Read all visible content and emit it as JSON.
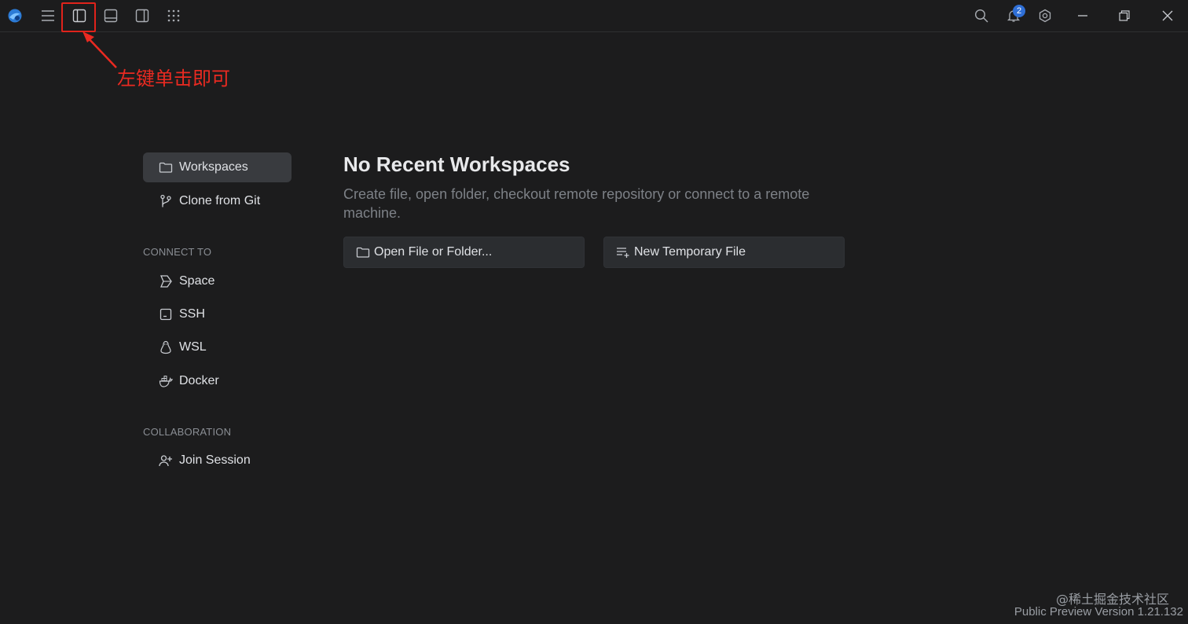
{
  "titlebar": {
    "icons": [
      "app-logo-icon",
      "hamburger-menu-icon",
      "toggle-left-panel-icon",
      "toggle-bottom-panel-icon",
      "toggle-right-panel-icon",
      "grid-apps-icon",
      "search-icon",
      "notification-bell-icon",
      "settings-gear-icon",
      "minimize-icon",
      "restore-icon",
      "close-icon"
    ],
    "notification_count": "2"
  },
  "annotation": {
    "text": "左键单击即可",
    "color": "#e0231b"
  },
  "sidebar": {
    "items": [
      {
        "label": "Workspaces",
        "icon": "folder-icon",
        "active": true
      },
      {
        "label": "Clone from Git",
        "icon": "git-branch-icon",
        "active": false
      }
    ],
    "connect_header": "CONNECT TO",
    "connect_items": [
      {
        "label": "Space",
        "icon": "space-icon"
      },
      {
        "label": "SSH",
        "icon": "terminal-icon"
      },
      {
        "label": "WSL",
        "icon": "linux-icon"
      },
      {
        "label": "Docker",
        "icon": "docker-icon"
      }
    ],
    "collab_header": "COLLABORATION",
    "collab_items": [
      {
        "label": "Join Session",
        "icon": "add-user-icon"
      }
    ]
  },
  "main": {
    "title": "No Recent Workspaces",
    "subtitle": "Create file, open folder, checkout remote repository or connect to a remote machine.",
    "buttons": {
      "open": "Open File or Folder...",
      "new_temp": "New Temporary File"
    }
  },
  "footer": {
    "watermark": "@稀土掘金技术社区",
    "version": "Public Preview Version 1.21.132"
  }
}
